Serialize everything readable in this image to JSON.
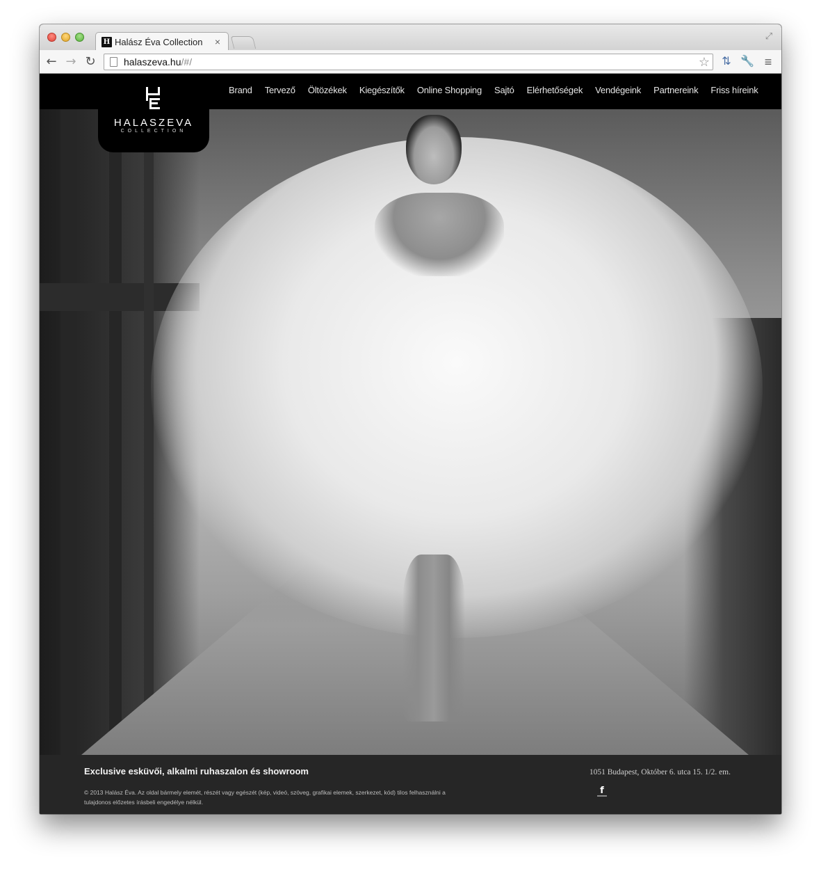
{
  "browser": {
    "tab_title": "Halász Éva Collection",
    "tab_close": "×",
    "url_host": "halaszeva.hu",
    "url_path": "/#/"
  },
  "site": {
    "logo_name": "HALASZEVA",
    "logo_sub": "COLLECTION",
    "menu": [
      "Brand",
      "Tervező",
      "Öltözékek",
      "Kiegészítők",
      "Online Shopping",
      "Sajtó",
      "Elérhetőségek",
      "Vendégeink",
      "Partnereink",
      "Friss híreink"
    ]
  },
  "footer": {
    "tagline": "Exclusive esküvői, alkalmi ruhaszalon és showroom",
    "copyright": "© 2013 Halász Éva. Az oldal bármely elemét, részét vagy egészét (kép, videó, szöveg, grafikai elemek, szerkezet, kód) tilos felhasználni a tulajdonos előzetes írásbeli engedélye nélkül.",
    "address": "1051 Budapest, Október 6. utca 15. 1/2. em.",
    "social_icon": "facebook-icon"
  }
}
